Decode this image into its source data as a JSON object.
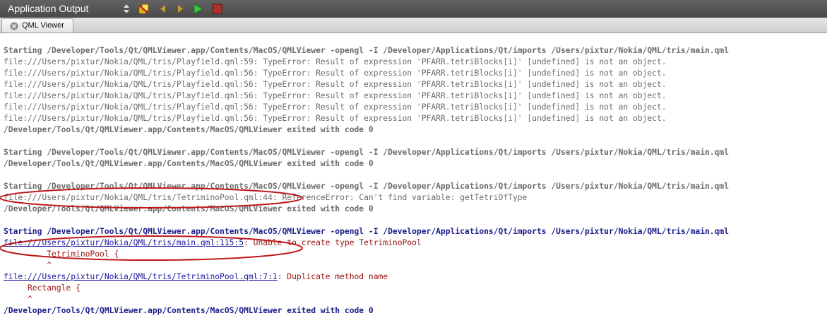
{
  "header": {
    "title": "Application Output",
    "icons": [
      "updown-arrows-icon",
      "attach-icon",
      "prev-arrow-icon",
      "next-arrow-icon",
      "run-play-icon",
      "stop-icon"
    ]
  },
  "tabs": [
    {
      "label": "QML Viewer"
    }
  ],
  "output": {
    "block1": {
      "start": "Starting /Developer/Tools/Qt/QMLViewer.app/Contents/MacOS/QMLViewer -opengl -I /Developer/Applications/Qt/imports /Users/pixtur/Nokia/QML/tris/main.qml",
      "errors": [
        "file:///Users/pixtur/Nokia/QML/tris/Playfield.qml:59: TypeError: Result of expression 'PFARR.tetriBlocks[i]' [undefined] is not an object.",
        "file:///Users/pixtur/Nokia/QML/tris/Playfield.qml:56: TypeError: Result of expression 'PFARR.tetriBlocks[i]' [undefined] is not an object.",
        "file:///Users/pixtur/Nokia/QML/tris/Playfield.qml:56: TypeError: Result of expression 'PFARR.tetriBlocks[i]' [undefined] is not an object.",
        "file:///Users/pixtur/Nokia/QML/tris/Playfield.qml:56: TypeError: Result of expression 'PFARR.tetriBlocks[i]' [undefined] is not an object.",
        "file:///Users/pixtur/Nokia/QML/tris/Playfield.qml:56: TypeError: Result of expression 'PFARR.tetriBlocks[i]' [undefined] is not an object.",
        "file:///Users/pixtur/Nokia/QML/tris/Playfield.qml:56: TypeError: Result of expression 'PFARR.tetriBlocks[i]' [undefined] is not an object."
      ],
      "exit": "/Developer/Tools/Qt/QMLViewer.app/Contents/MacOS/QMLViewer exited with code 0"
    },
    "block2": {
      "start": "Starting /Developer/Tools/Qt/QMLViewer.app/Contents/MacOS/QMLViewer -opengl -I /Developer/Applications/Qt/imports /Users/pixtur/Nokia/QML/tris/main.qml",
      "exit": "/Developer/Tools/Qt/QMLViewer.app/Contents/MacOS/QMLViewer exited with code 0"
    },
    "block3": {
      "start": "Starting /Developer/Tools/Qt/QMLViewer.app/Contents/MacOS/QMLViewer -opengl -I /Developer/Applications/Qt/imports /Users/pixtur/Nokia/QML/tris/main.qml",
      "error": "file:///Users/pixtur/Nokia/QML/tris/TetriminoPool.qml:44: ReferenceError: Can't find variable: getTetriOfType",
      "exit": "/Developer/Tools/Qt/QMLViewer.app/Contents/MacOS/QMLViewer exited with code 0"
    },
    "block4": {
      "start": "Starting /Developer/Tools/Qt/QMLViewer.app/Contents/MacOS/QMLViewer -opengl -I /Developer/Applications/Qt/imports /Users/pixtur/Nokia/QML/tris/main.qml",
      "err1_link": "file:///Users/pixtur/Nokia/QML/tris/main.qml:115:5",
      "err1_msg": ": Unable to create type TetriminoPool",
      "err1_code": "         TetriminoPool {",
      "err1_caret": "         ^",
      "err2_link": "file:///Users/pixtur/Nokia/QML/tris/TetriminoPool.qml:7:1",
      "err2_msg": ": Duplicate method name",
      "err2_code": "     Rectangle {",
      "err2_caret": "     ^",
      "exit": "/Developer/Tools/Qt/QMLViewer.app/Contents/MacOS/QMLViewer exited with code 0"
    }
  }
}
